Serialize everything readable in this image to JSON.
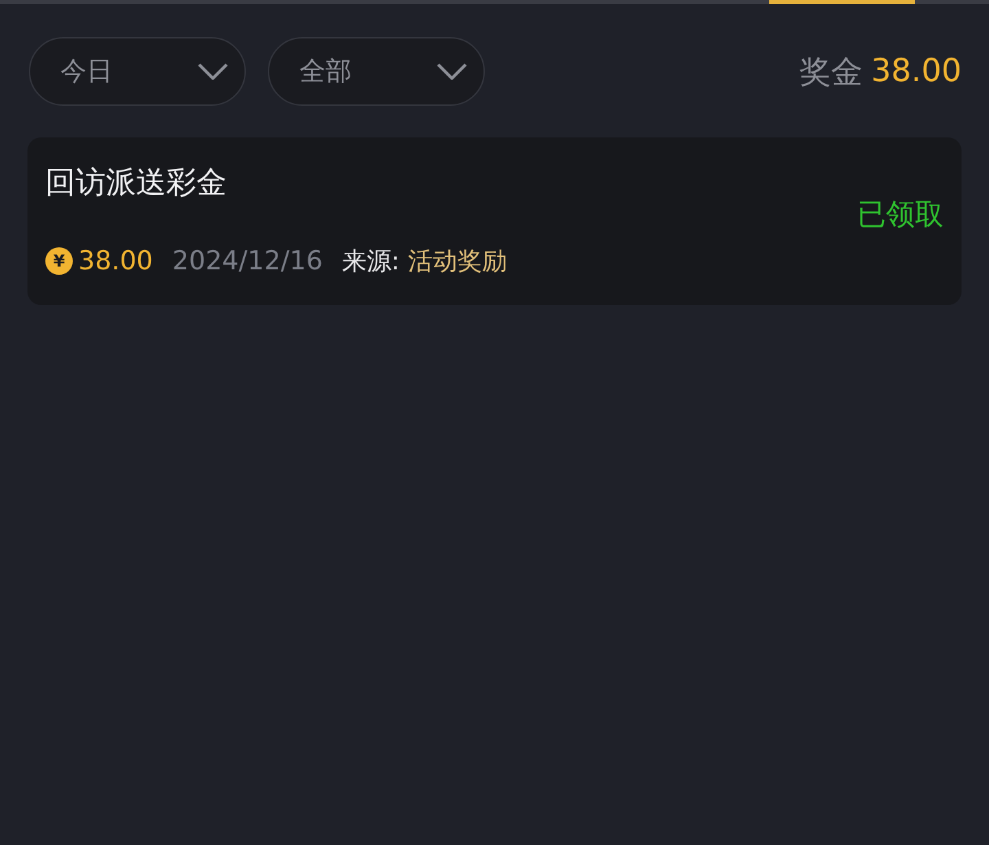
{
  "filters": [
    {
      "label": "今日"
    },
    {
      "label": "全部"
    }
  ],
  "bonus_total": {
    "label": "奖金",
    "amount": "38.00"
  },
  "records": [
    {
      "title": "回访派送彩金",
      "status": "已领取",
      "claimed": true,
      "coin_symbol": "¥",
      "amount": "38.00",
      "date": "2024/12/16",
      "source_label": "来源:",
      "source": "活动奖励"
    }
  ]
}
